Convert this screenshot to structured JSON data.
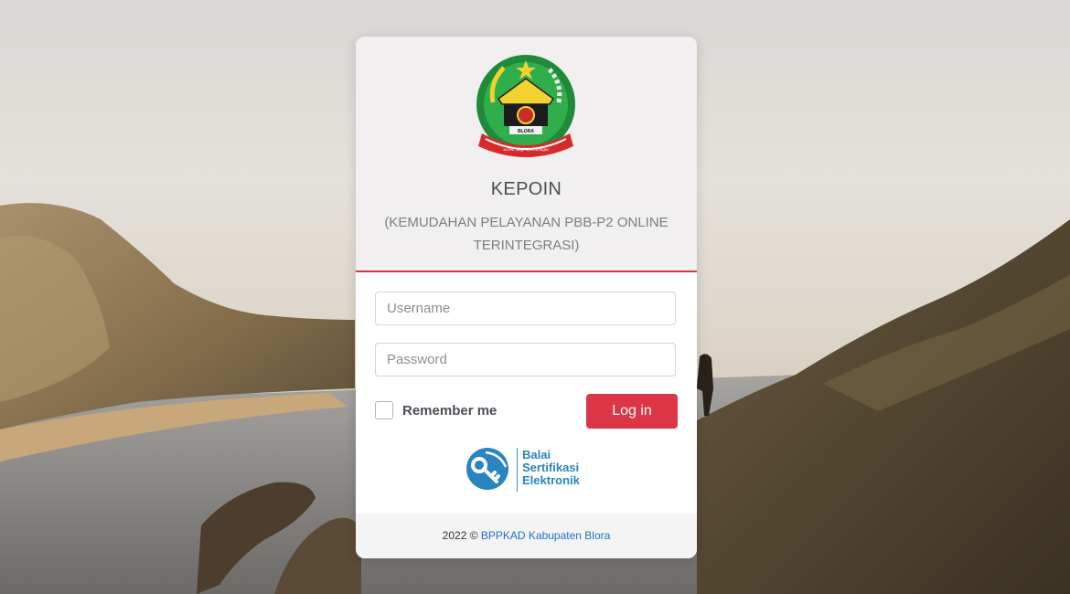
{
  "app": {
    "title": "KEPOIN",
    "subtitle": "(KEMUDAHAN PELAYANAN PBB-P2 ONLINE TERINTEGRASI)",
    "logo_caption": "BLORA",
    "logo_motto": "sarwa mugi ayu bahagia"
  },
  "form": {
    "username_placeholder": "Username",
    "password_placeholder": "Password",
    "remember_label": "Remember me",
    "login_label": "Log in"
  },
  "badge": {
    "line1": "Balai",
    "line2": "Sertifikasi",
    "line3": "Elektronik"
  },
  "footer": {
    "prefix": "2022 ©",
    "link_text": "BPPKAD Kabupaten Blora"
  },
  "colors": {
    "accent": "#dc3545",
    "link": "#1a73c9",
    "badge": "#2a84bf"
  }
}
